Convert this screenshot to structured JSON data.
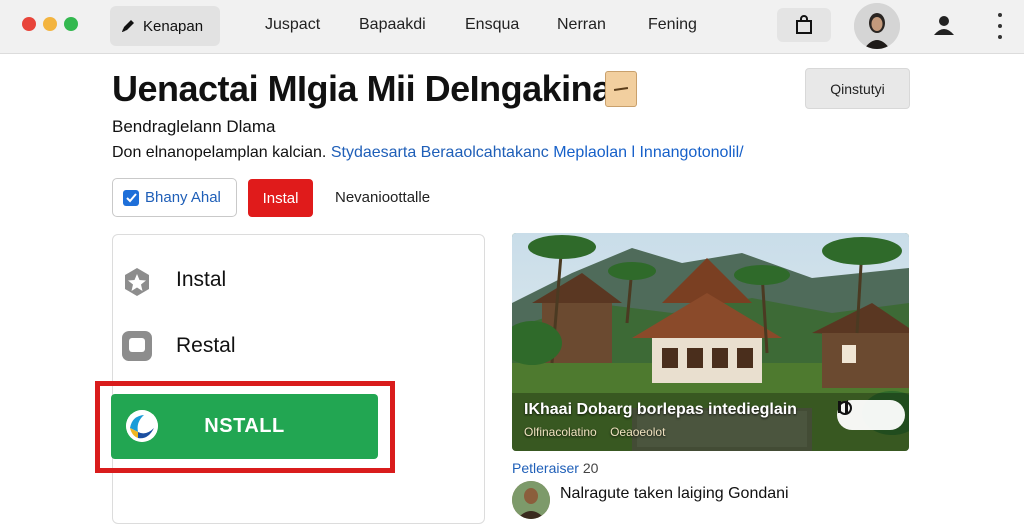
{
  "topbar": {
    "active_tab_label": "Kenapan",
    "nav_links": [
      "Juspact",
      "Bapaakdi",
      "Ensqua",
      "Nerran",
      "Fening"
    ]
  },
  "header": {
    "title": "Uenactai MIgia Mii DeIngakina",
    "options_label": "Qinstutyi",
    "subtitle": "Bendraglelann Dlama",
    "desc_plain": "Don elnanopelamplan kalcian.",
    "desc_link_1": "Stydaesarta Beraaolcahtakanc",
    "desc_link_2": "Meplaolan l Innangotonolil/",
    "share_label": "Bhany Ahal",
    "install_small_label": "Instal",
    "aux_label": "Nevanioottalle"
  },
  "left_panel": {
    "items": [
      {
        "label": "Instal",
        "icon": "star-badge-icon"
      },
      {
        "label": "Restal",
        "icon": "square-chat-icon"
      }
    ],
    "install_button_label": "NSTALL"
  },
  "media": {
    "caption": "IKhaai Dobarg borlepas intedieglain",
    "meta_left": "Olfinacolatino",
    "meta_right": "Oeaoeolot",
    "control_left": "play-loop-icon",
    "control_right": "pause-icon"
  },
  "comment": {
    "author": "Petleraiser",
    "count": "20",
    "text": "Nalragute taken laiging Gondani"
  },
  "colors": {
    "accent_red": "#e01b1b",
    "install_green": "#22a652",
    "link_blue": "#1f5fb8"
  }
}
